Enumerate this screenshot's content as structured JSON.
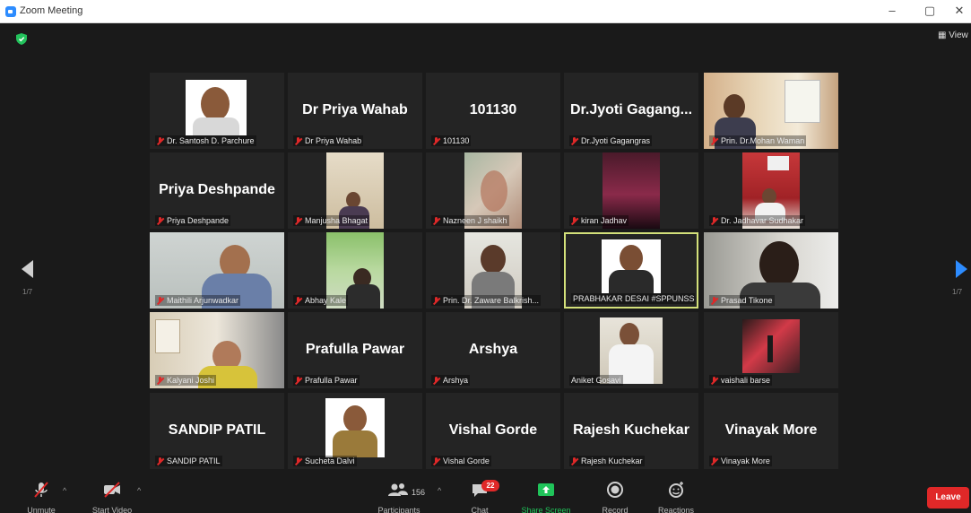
{
  "window": {
    "title": "Zoom Meeting",
    "minimize": "–",
    "maximize": "▢",
    "close": "✕"
  },
  "top": {
    "view_label": "View"
  },
  "pager": {
    "left": "1/7",
    "right": "1/7"
  },
  "participants": [
    {
      "label": "Dr. Santosh D. Parchure",
      "big": "",
      "video": true
    },
    {
      "label": "Dr Priya Wahab",
      "big": "Dr Priya Wahab",
      "video": false
    },
    {
      "label": "101130",
      "big": "101130",
      "video": false
    },
    {
      "label": "Dr.Jyoti Gagangras",
      "big": "Dr.Jyoti  Gagang...",
      "video": false
    },
    {
      "label": "Prin. Dr.Mohan Waman",
      "big": "",
      "video": true
    },
    {
      "label": "Priya Deshpande",
      "big": "Priya Deshpande",
      "video": false
    },
    {
      "label": "Manjusha Bhagat",
      "big": "",
      "video": true
    },
    {
      "label": "Nazneen J shaikh",
      "big": "",
      "video": true
    },
    {
      "label": "kiran Jadhav",
      "big": "",
      "video": true
    },
    {
      "label": "Dr. Jadhavar Sudhakar",
      "big": "",
      "video": true
    },
    {
      "label": "Maithili Arjunwadkar",
      "big": "",
      "video": true
    },
    {
      "label": "Abhay Kale",
      "big": "",
      "video": true
    },
    {
      "label": "Prin. Dr. Zaware  Balkrish...",
      "big": "",
      "video": true
    },
    {
      "label": "PRABHAKAR DESAI #SPPUNSS",
      "big": "",
      "video": true,
      "active": true
    },
    {
      "label": "Prasad Tikone",
      "big": "",
      "video": true
    },
    {
      "label": "Kalyani Joshi",
      "big": "",
      "video": true
    },
    {
      "label": "Prafulla Pawar",
      "big": "Prafulla Pawar",
      "video": false
    },
    {
      "label": "Arshya",
      "big": "Arshya",
      "video": false
    },
    {
      "label": "Aniket Gosavi",
      "big": "",
      "video": true,
      "unmuted": true
    },
    {
      "label": "vaishali barse",
      "big": "",
      "video": true
    },
    {
      "label": "SANDIP PATIL",
      "big": "SANDIP PATIL",
      "video": false
    },
    {
      "label": "Sucheta Dalvi",
      "big": "",
      "video": true
    },
    {
      "label": "Vishal Gorde",
      "big": "Vishal Gorde",
      "video": false
    },
    {
      "label": "Rajesh Kuchekar",
      "big": "Rajesh Kuchekar",
      "video": false
    },
    {
      "label": "Vinayak More",
      "big": "Vinayak More",
      "video": false
    }
  ],
  "toolbar": {
    "unmute": "Unmute",
    "start_video": "Start Video",
    "participants": "Participants",
    "participant_count": "156",
    "chat": "Chat",
    "chat_badge": "22",
    "share_screen": "Share Screen",
    "record": "Record",
    "reactions": "Reactions",
    "leave": "Leave"
  },
  "colors": {
    "share": "#20c45a",
    "leave": "#e02828",
    "active_border": "#d3e07a",
    "nav_right": "#2d8cff"
  }
}
